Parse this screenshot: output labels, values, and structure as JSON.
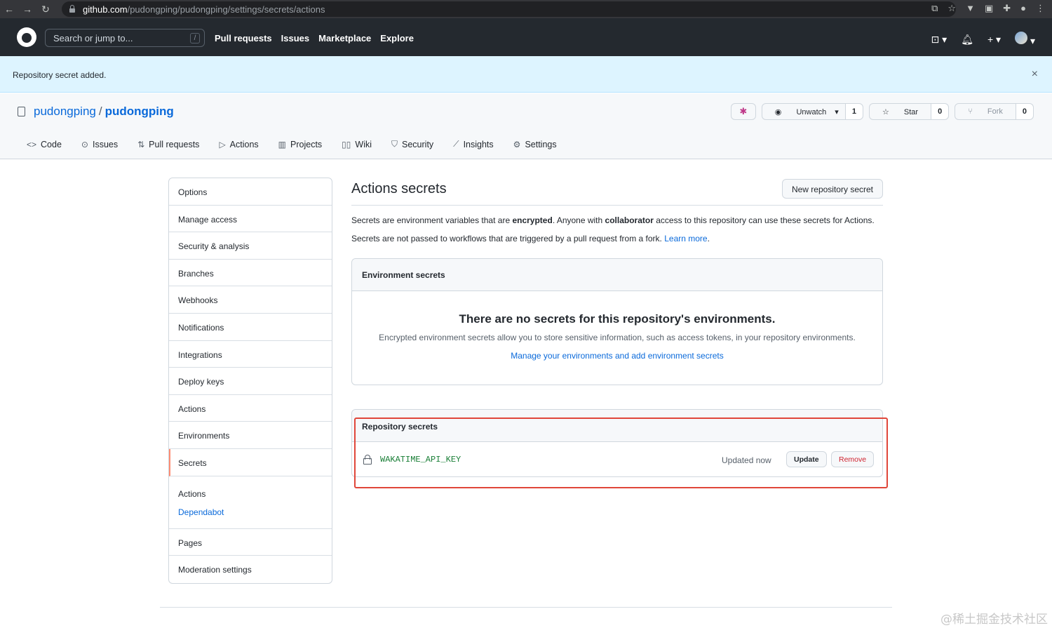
{
  "browser": {
    "url_host": "github.com",
    "url_path": "/pudongping/pudongping/settings/secrets/actions"
  },
  "header": {
    "search_placeholder": "Search or jump to...",
    "search_shortcut": "/",
    "nav": [
      "Pull requests",
      "Issues",
      "Marketplace",
      "Explore"
    ]
  },
  "flash": {
    "message": "Repository secret added."
  },
  "repo": {
    "owner": "pudongping",
    "name": "pudongping",
    "watch_label": "Unwatch",
    "watch_count": "1",
    "star_label": "Star",
    "star_count": "0",
    "fork_label": "Fork",
    "fork_count": "0",
    "tabs": [
      "Code",
      "Issues",
      "Pull requests",
      "Actions",
      "Projects",
      "Wiki",
      "Security",
      "Insights",
      "Settings"
    ]
  },
  "sidebar": {
    "items": [
      "Options",
      "Manage access",
      "Security & analysis",
      "Branches",
      "Webhooks",
      "Notifications",
      "Integrations",
      "Deploy keys",
      "Actions",
      "Environments",
      "Secrets"
    ],
    "group_head": "Actions",
    "group_link": "Dependabot",
    "bottom_items": [
      "Pages",
      "Moderation settings"
    ]
  },
  "main": {
    "title": "Actions secrets",
    "new_button": "New repository secret",
    "desc1_a": "Secrets are environment variables that are ",
    "desc1_b": "encrypted",
    "desc1_c": ". Anyone with ",
    "desc1_d": "collaborator",
    "desc1_e": " access to this repository can use these secrets for Actions.",
    "desc2_a": "Secrets are not passed to workflows that are triggered by a pull request from a fork. ",
    "desc2_link": "Learn more",
    "desc2_end": ".",
    "env_head": "Environment secrets",
    "env_empty_title": "There are no secrets for this repository's environments.",
    "env_empty_desc": "Encrypted environment secrets allow you to store sensitive information, such as access tokens, in your repository environments.",
    "env_empty_link": "Manage your environments and add environment secrets",
    "repo_head": "Repository secrets",
    "secrets": [
      {
        "name": "WAKATIME_API_KEY",
        "updated": "Updated now",
        "update_label": "Update",
        "remove_label": "Remove"
      }
    ]
  },
  "watermark": "@稀土掘金技术社区"
}
